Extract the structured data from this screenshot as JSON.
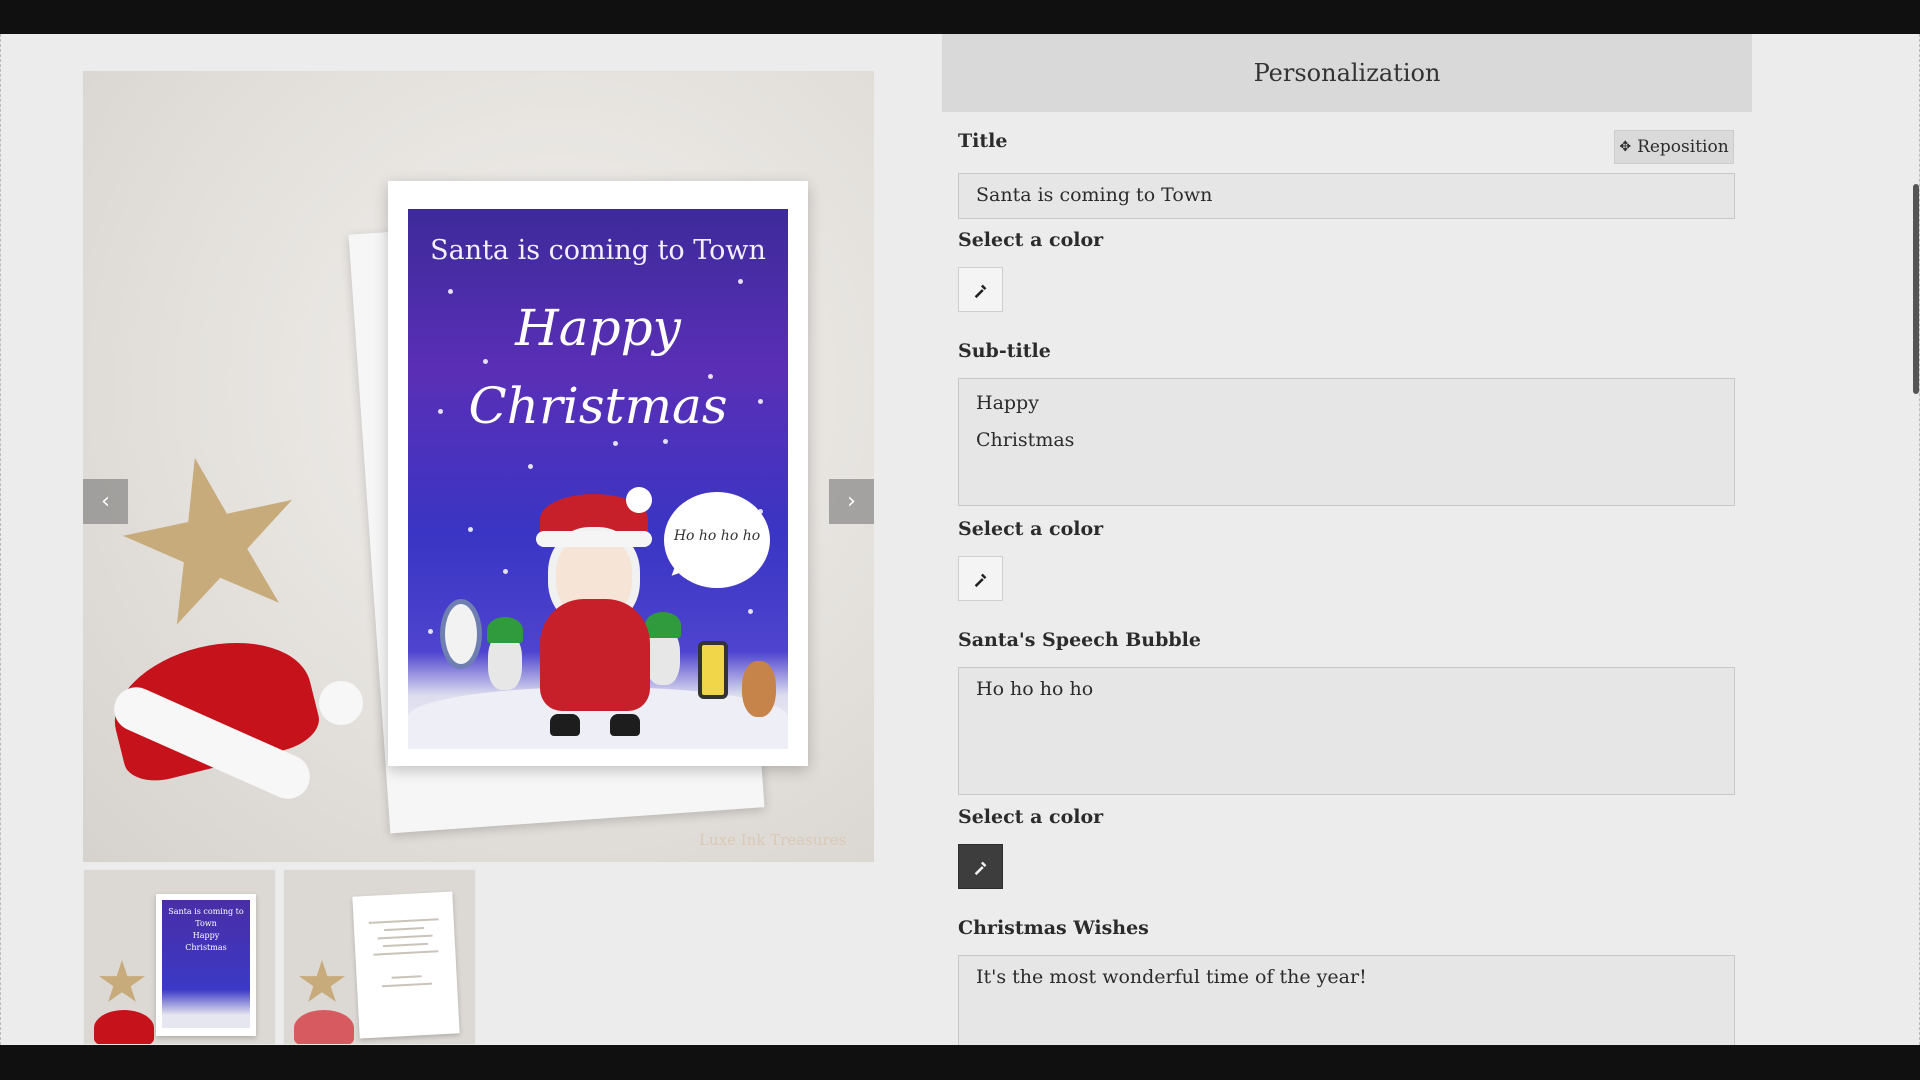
{
  "preview": {
    "card_title": "Santa is coming to Town",
    "card_subtitle": "Happy\nChristmas",
    "speech_bubble": "Ho ho ho ho",
    "watermark": "Luxe Ink Treasures",
    "prev_icon": "chevron-left-icon",
    "next_icon": "chevron-right-icon",
    "prev_glyph": "‹",
    "next_glyph": "›",
    "thumbnails": [
      {
        "card_text": "Santa is coming to Town\nHappy\nChristmas"
      },
      {
        "card_text": ""
      }
    ]
  },
  "panel": {
    "header": "Personalization",
    "reposition_label": "Reposition",
    "fields": [
      {
        "label": "Title",
        "value": "Santa is coming to Town",
        "color_label": "Select a color"
      },
      {
        "label": "Sub-title",
        "value": "Happy\nChristmas",
        "color_label": "Select a color"
      },
      {
        "label": "Santa's Speech Bubble",
        "value": "Ho ho ho ho",
        "color_label": "Select a color"
      },
      {
        "label": "Christmas Wishes",
        "value": "It's the most wonderful time of the year!"
      }
    ],
    "color_swatches": [
      "#f4f4f4",
      "#f4f4f4",
      "#3d3d3d"
    ]
  },
  "colors": {
    "card_background": "#4a35c0",
    "panel_header": "#d9d9d9",
    "page_background": "#ececec"
  }
}
